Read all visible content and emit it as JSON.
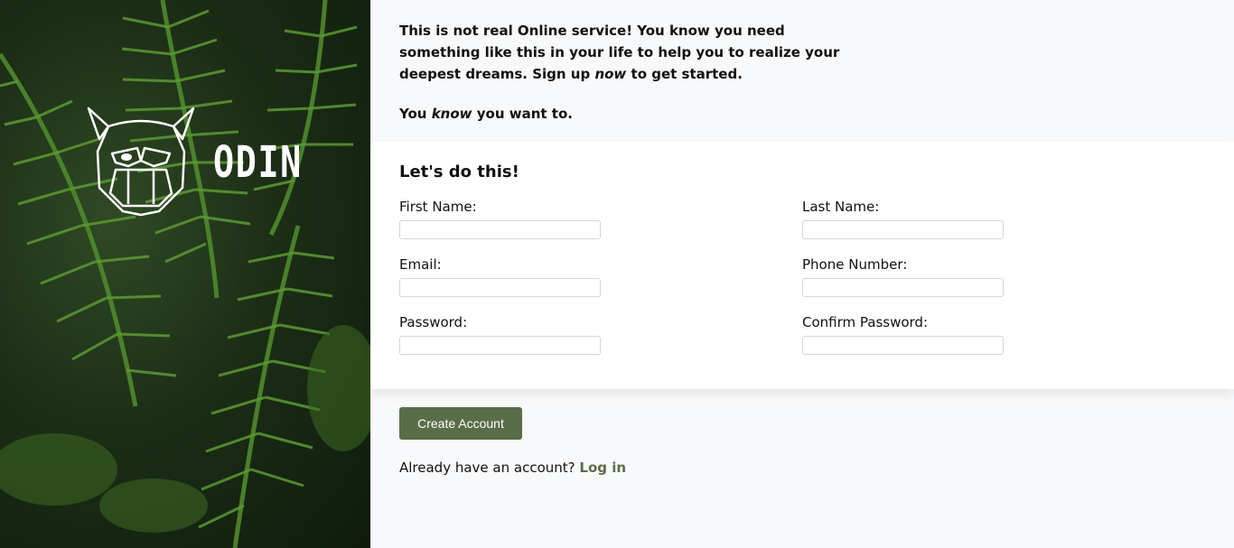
{
  "brand": {
    "name": "ODIN",
    "logo_icon": "viking-helmet-logo-icon"
  },
  "intro": {
    "line1_part1": "This is not real Online service! You know you need something like this in your life to help you to realize your deepest dreams. Sign up ",
    "line1_em": "now",
    "line1_part2": " to get started.",
    "line2_part1": "You ",
    "line2_em": "know",
    "line2_part2": " you want to."
  },
  "form": {
    "heading": "Let's do this!",
    "fields": {
      "first_name": "First Name:",
      "last_name": "Last Name:",
      "email": "Email:",
      "phone": "Phone Number:",
      "password": "Password:",
      "confirm_password": "Confirm Password:"
    }
  },
  "actions": {
    "create_label": "Create Account",
    "login_prompt": "Already have an account? ",
    "login_link": "Log in"
  },
  "colors": {
    "accent": "#596d48",
    "background": "#f8f9fa",
    "card": "#ffffff"
  }
}
